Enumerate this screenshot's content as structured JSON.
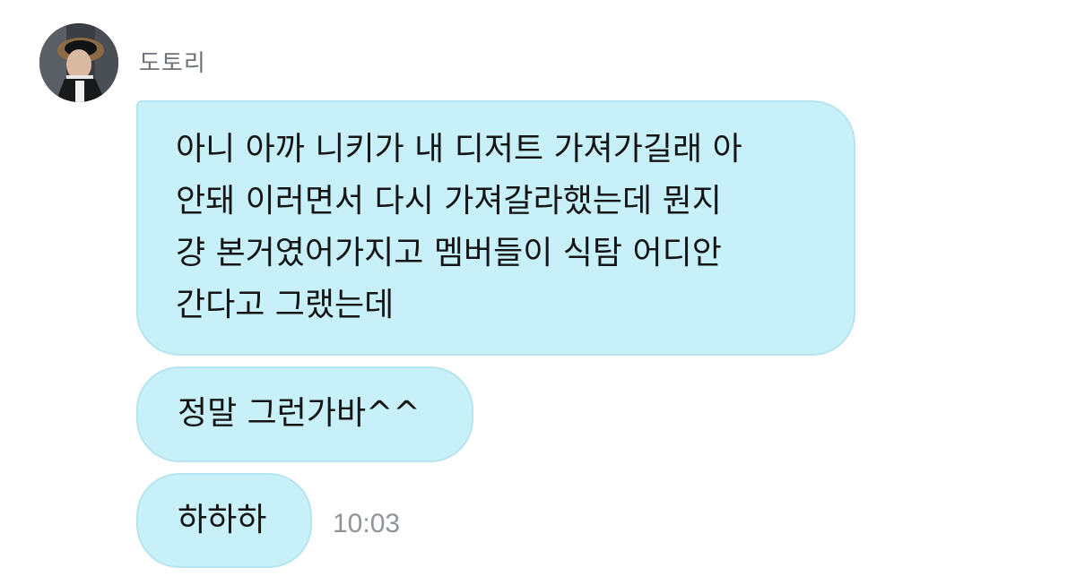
{
  "sender": {
    "name": "도토리"
  },
  "messages": [
    {
      "lines": [
        "아니 아까 니키가 내 디저트 가져가길래 아",
        "안돼 이러면서 다시 가져갈라했는데 뭔지",
        "걍 본거였어가지고 멤버들이 식탐 어디안",
        "간다고 그랬는데"
      ]
    },
    {
      "text": "정말 그런가바^^"
    },
    {
      "text": "하하하",
      "time": "10:03"
    }
  ],
  "colors": {
    "bubble_bg": "#c8f0f8",
    "bubble_border": "#b6e4ef",
    "name_text": "#6d7278",
    "time_text": "#8e9499"
  }
}
